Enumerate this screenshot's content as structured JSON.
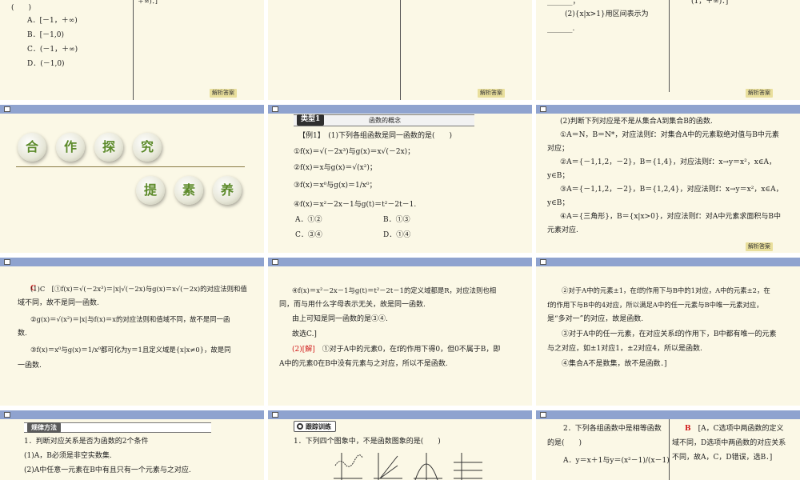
{
  "slide1": {
    "paren": "(　　)",
    "options": [
      "A．[－1，＋∞)",
      "B．[－1,0)",
      "C．(－1，＋∞)",
      "D．(－1,0)"
    ],
    "right_text": "＋∞)．]",
    "answer_btn": "解析答案"
  },
  "slide2": {
    "answer_btn": "解析答案"
  },
  "slide3": {
    "line1": "_______；",
    "line2": "(2){x|x>1}用区间表示为",
    "line3": "_______.",
    "right_text": "(1，＋∞)．]",
    "answer_btn": "解析答案"
  },
  "slide4": {
    "title_chars": [
      "合",
      "作",
      "探",
      "究"
    ],
    "sub_chars": [
      "提",
      "素",
      "养"
    ]
  },
  "slide5": {
    "tab": "类型1",
    "strip": "函数的概念",
    "example": "【例1】　(1)下列各组函数是同一函数的是(　　)",
    "items": [
      "①f(x)＝√(－2x³)与g(x)＝x√(－2x)；",
      "②f(x)＝x与g(x)＝√(x²)；",
      "③f(x)＝x⁰与g(x)＝1/x⁰；",
      "④f(x)＝x²－2x－1与g(t)＝t²－2t－1."
    ],
    "opt_a": "A．①②",
    "opt_b": "B．①③",
    "opt_c": "C．③④",
    "opt_d": "D．①④"
  },
  "slide6": {
    "lines": [
      "(2)判断下列对应是不是从集合A到集合B的函数.",
      "①A＝N，B＝N*，对应法则f：对集合A中的元素取绝对值与B中元素",
      "对应；",
      "②A＝{－1,1,2，－2}，B＝{1,4}，对应法则f：x→y＝x²，x∈A，",
      "y∈B；",
      "③A＝{－1,1,2，－2}，B＝{1,2,4}，对应法则f：x→y＝x²，x∈A，",
      "y∈B；",
      "④A＝{三角形}，B＝{x|x>0}，对应法则f：对A中元素求面积与B中",
      "元素对应."
    ],
    "answer_btn": "解析答案"
  },
  "slide7": {
    "answer_letter": "C",
    "l1": "(1)C　[①f(x)＝√(－2x³)＝|x|√(－2x)与g(x)＝x√(－2x)的对应法则和值",
    "l2": "域不同，故不是同一函数.",
    "l3": "②g(x)＝√(x²)＝|x|与f(x)＝x的对应法则和值域不同，故不是同一函",
    "l4": "数.",
    "l5": "③f(x)＝x⁰与g(x)＝1/x⁰都可化为y＝1且定义域是{x|x≠0}，故是同",
    "l6": "一函数."
  },
  "slide8": {
    "l1": "④f(x)＝x²－2x－1与g(t)＝t²－2t－1的定义域都是R，对应法则也相",
    "l2": "同，而与用什么字母表示无关，故是同一函数.",
    "l3": "由上可知是同一函数的是③④.",
    "l4": "故选C.]",
    "l5_tag": "(2)[解]",
    "l5_rest": "①对于A中的元素0，在f的作用下得0，但0不属于B，即",
    "l6": "A中的元素0在B中没有元素与之对应，所以不是函数."
  },
  "slide9": {
    "l1": "②对于A中的元素±1，在f的作用下与B中的1对应，A中的元素±2，在",
    "l2": "f的作用下与B中的4对应，所以满足A中的任一元素与B中唯一元素对应，",
    "l3": "是“多对一”的对应，故是函数.",
    "l4": "③对于A中的任一元素，在对应关系f的作用下，B中都有唯一的元素",
    "l5": "与之对应，如±1对应1，±2对应4，所以是函数.",
    "l6": "④集合A不是数集，故不是函数．]"
  },
  "slide10": {
    "tab": "规律方法",
    "l1": "1．判断对应关系是否为函数的2个条件",
    "l2": "(1)A，B必须是非空实数集.",
    "l3": "(2)A中任意一元素在B中有且只有一个元素与之对应."
  },
  "slide11": {
    "tab": "跟踪训练",
    "l1": "1．下列四个图象中，不是函数图象的是(　　)"
  },
  "slide12": {
    "l1": "2．下列各组函数中是相等函数",
    "l2": "的是(　　)",
    "l3": "A．y＝x＋1与y＝(x²－1)/(x－1)",
    "r_letter": "B",
    "r1": "[A，C选项中两函数的定义",
    "r2": "域不同，D选项中两函数的对应关系",
    "r3": "不同，故A，C，D错误，选B．]"
  }
}
